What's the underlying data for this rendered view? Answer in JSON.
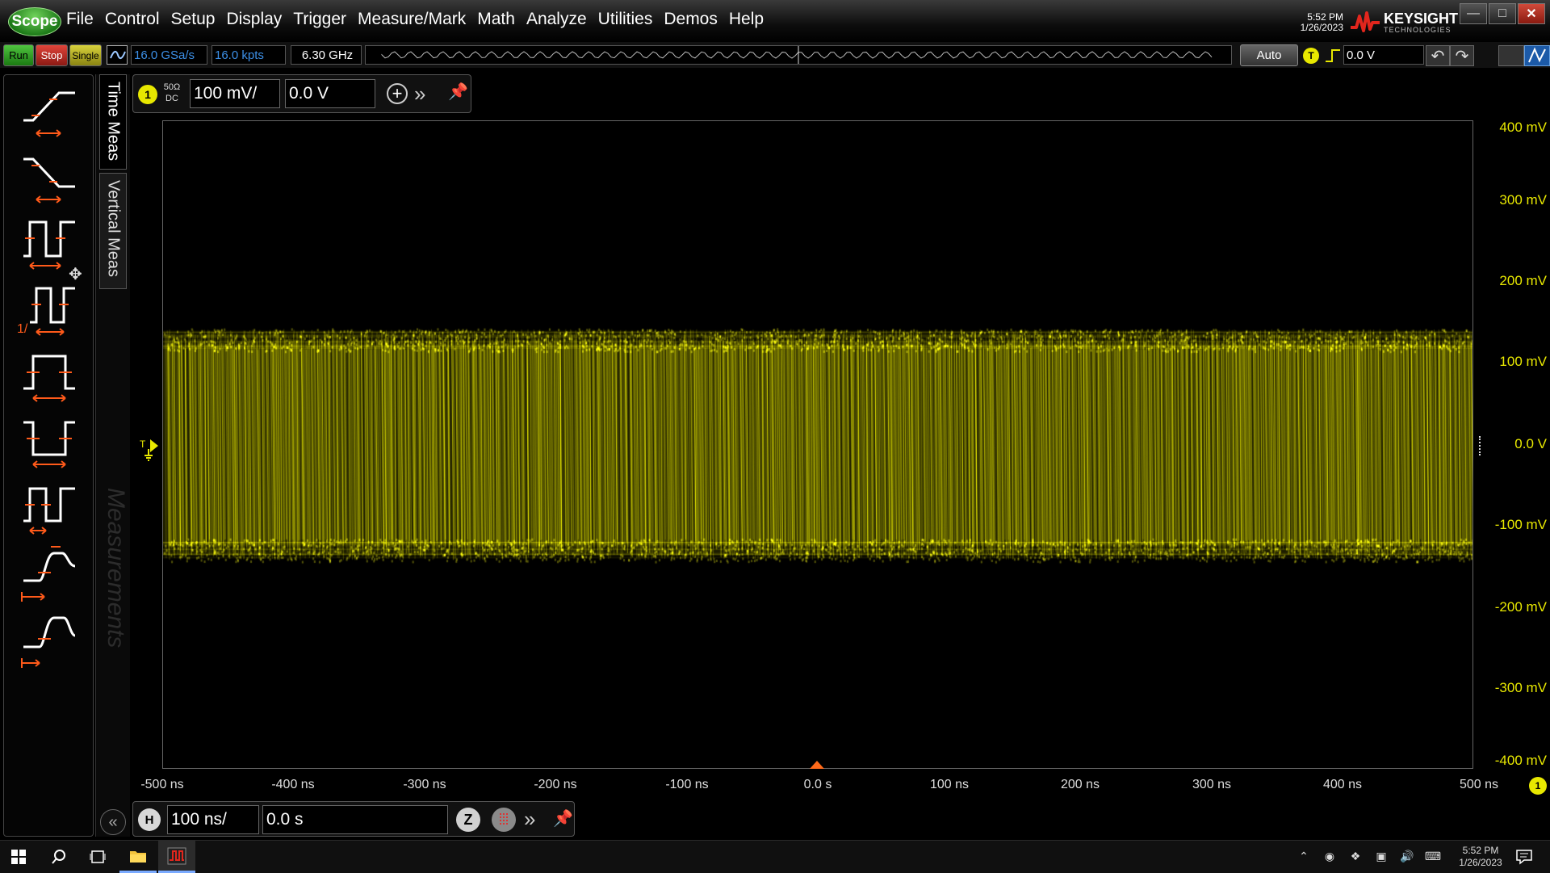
{
  "app": {
    "logo_label": "Scope"
  },
  "menu": [
    "File",
    "Control",
    "Setup",
    "Display",
    "Trigger",
    "Measure/Mark",
    "Math",
    "Analyze",
    "Utilities",
    "Demos",
    "Help"
  ],
  "status_clock": {
    "time": "5:52 PM",
    "date": "1/26/2023"
  },
  "brand": {
    "name": "KEYSIGHT",
    "sub": "TECHNOLOGIES"
  },
  "toolbar": {
    "run_label": "Run",
    "stop_label": "Stop",
    "single_label": "Single",
    "sample_rate": "16.0 GSa/s",
    "memory_depth": "16.0 kpts",
    "bandwidth": "6.30 GHz",
    "trigger_mode": "Auto",
    "trigger_badge": "T",
    "trigger_level": "0.0 V"
  },
  "left_panel": {
    "tabs": [
      "Time Meas",
      "Vertical Meas"
    ],
    "watermark": "Measurements",
    "period_label_prefix": "1/"
  },
  "channel": {
    "number": "1",
    "coupling_line1": "50Ω",
    "coupling_line2": "DC",
    "scale": "100 mV/",
    "offset": "0.0 V",
    "color": "#e8e800"
  },
  "horizontal": {
    "badge": "H",
    "scale": "100 ns/",
    "position": "0.0 s",
    "zoom_label": "Z"
  },
  "graticule": {
    "y_labels": [
      "400 mV",
      "300 mV",
      "200 mV",
      "100 mV",
      "0.0 V",
      "-100 mV",
      "-200 mV",
      "-300 mV",
      "-400 mV"
    ],
    "x_labels": [
      "-500 ns",
      "-400 ns",
      "-300 ns",
      "-200 ns",
      "-100 ns",
      "0.0 s",
      "100 ns",
      "200 ns",
      "300 ns",
      "400 ns",
      "500 ns"
    ],
    "trace_color": "#e6e600"
  },
  "trace": {
    "high_mV": 130,
    "low_mV": -130,
    "time_range_ns": [
      -500,
      500
    ]
  },
  "taskbar": {
    "time": "5:52 PM",
    "date": "1/26/2023"
  }
}
